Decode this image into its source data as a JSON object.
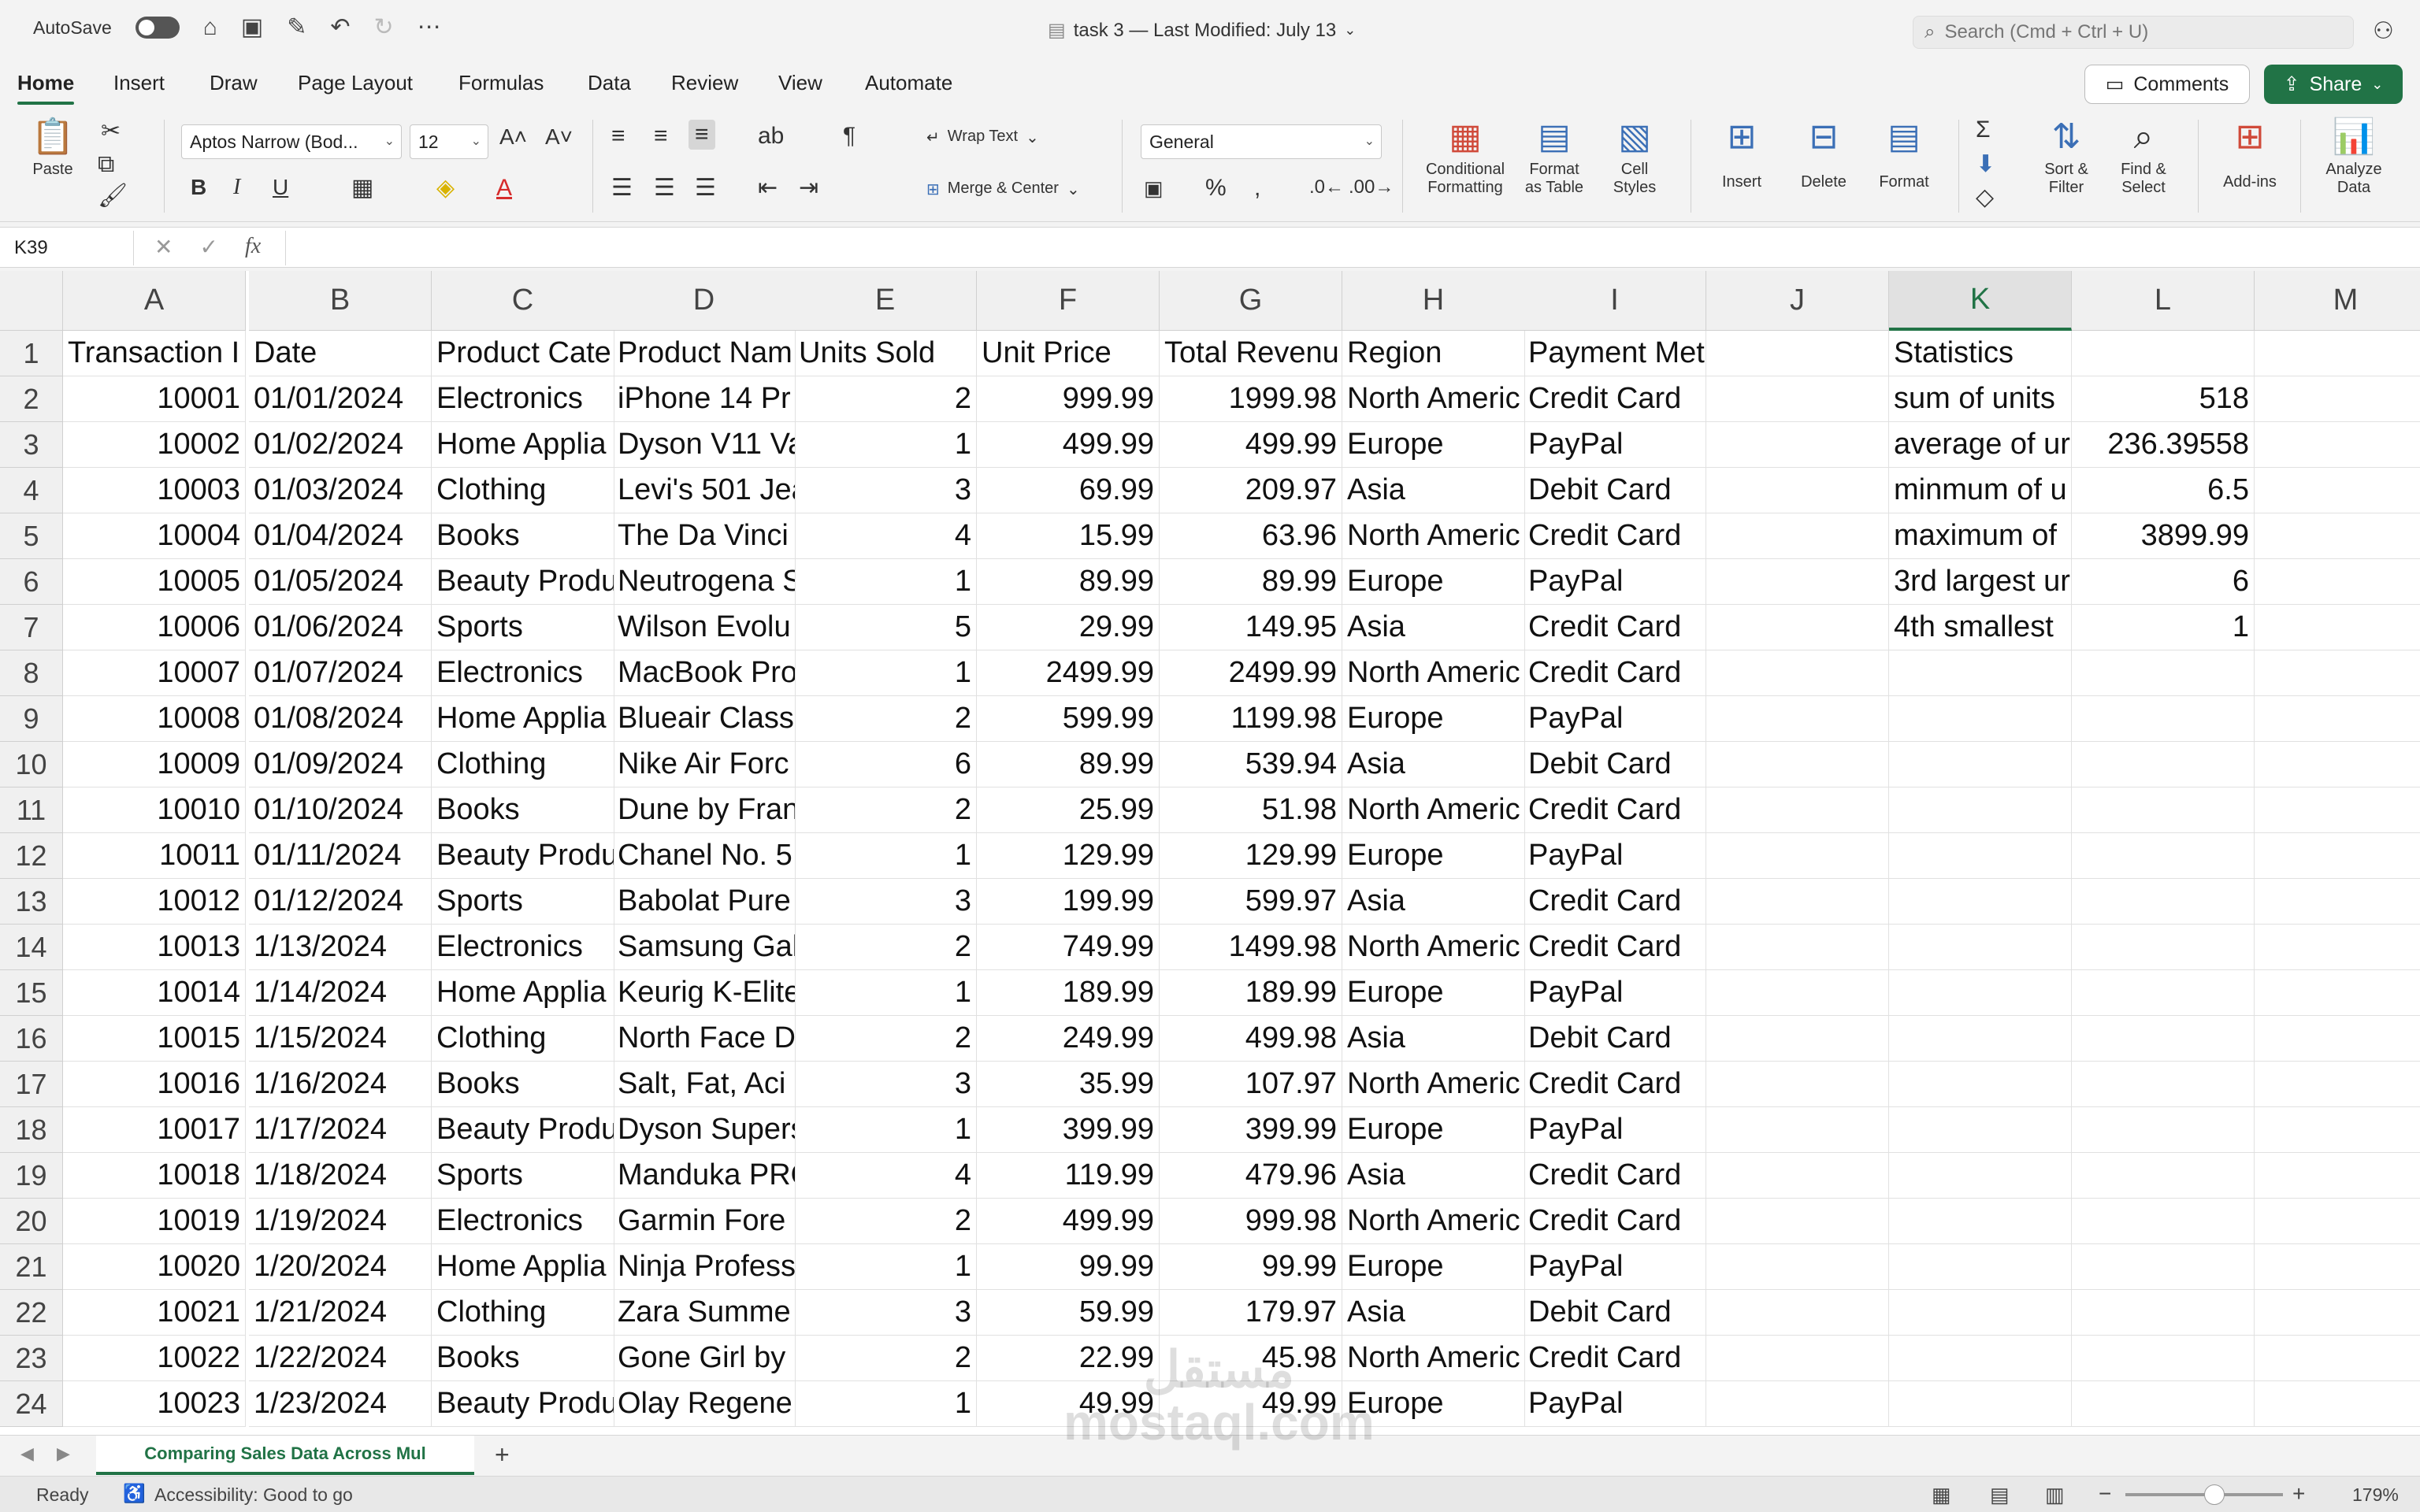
{
  "titlebar": {
    "autosave_label": "AutoSave",
    "document_title": "task 3 — Last Modified: July 13",
    "search_placeholder": "Search (Cmd + Ctrl + U)"
  },
  "tabs": [
    "Home",
    "Insert",
    "Draw",
    "Page Layout",
    "Formulas",
    "Data",
    "Review",
    "View",
    "Automate"
  ],
  "actions": {
    "comments": "Comments",
    "share": "Share"
  },
  "ribbon": {
    "paste": "Paste",
    "font_name": "Aptos Narrow (Bod...",
    "font_size": "12",
    "wrap_text": "Wrap Text",
    "merge_center": "Merge & Center",
    "number_format": "General",
    "conditional_formatting_1": "Conditional",
    "conditional_formatting_2": "Formatting",
    "format_as_table_1": "Format",
    "format_as_table_2": "as Table",
    "cell_styles_1": "Cell",
    "cell_styles_2": "Styles",
    "insert": "Insert",
    "delete": "Delete",
    "format": "Format",
    "sort_filter_1": "Sort &",
    "sort_filter_2": "Filter",
    "find_select_1": "Find &",
    "find_select_2": "Select",
    "addins": "Add-ins",
    "analyze_data_1": "Analyze",
    "analyze_data_2": "Data"
  },
  "formula_bar": {
    "name_box": "K39",
    "formula": ""
  },
  "columns": [
    "A",
    "B",
    "C",
    "D",
    "E",
    "F",
    "G",
    "H",
    "I",
    "J",
    "K",
    "L",
    "M"
  ],
  "selected_column": "K",
  "rows": [
    [
      "Transaction I",
      "Date",
      "Product Cate",
      "Product Nam",
      "Units Sold",
      "Unit Price",
      "Total Revenu",
      "Region",
      "Payment Method",
      "",
      "Statistics",
      "",
      ""
    ],
    [
      "10001",
      "01/01/2024",
      "Electronics",
      "iPhone 14 Pr",
      "2",
      "999.99",
      "1999.98",
      "North Americ",
      "Credit Card",
      "",
      "sum of units",
      "518",
      ""
    ],
    [
      "10002",
      "01/02/2024",
      "Home Applia",
      "Dyson V11 Va",
      "1",
      "499.99",
      "499.99",
      "Europe",
      "PayPal",
      "",
      "average of ur",
      "236.39558",
      ""
    ],
    [
      "10003",
      "01/03/2024",
      "Clothing",
      "Levi's 501 Jea",
      "3",
      "69.99",
      "209.97",
      "Asia",
      "Debit Card",
      "",
      "minmum of u",
      "6.5",
      ""
    ],
    [
      "10004",
      "01/04/2024",
      "Books",
      "The Da Vinci",
      "4",
      "15.99",
      "63.96",
      "North Americ",
      "Credit Card",
      "",
      "maximum of",
      "3899.99",
      ""
    ],
    [
      "10005",
      "01/05/2024",
      "Beauty Produ",
      "Neutrogena S",
      "1",
      "89.99",
      "89.99",
      "Europe",
      "PayPal",
      "",
      "3rd largest ur",
      "6",
      ""
    ],
    [
      "10006",
      "01/06/2024",
      "Sports",
      "Wilson Evolu",
      "5",
      "29.99",
      "149.95",
      "Asia",
      "Credit Card",
      "",
      "4th smallest",
      "1",
      ""
    ],
    [
      "10007",
      "01/07/2024",
      "Electronics",
      "MacBook Pro",
      "1",
      "2499.99",
      "2499.99",
      "North Americ",
      "Credit Card",
      "",
      "",
      "",
      ""
    ],
    [
      "10008",
      "01/08/2024",
      "Home Applia",
      "Blueair Class",
      "2",
      "599.99",
      "1199.98",
      "Europe",
      "PayPal",
      "",
      "",
      "",
      ""
    ],
    [
      "10009",
      "01/09/2024",
      "Clothing",
      "Nike Air Forc",
      "6",
      "89.99",
      "539.94",
      "Asia",
      "Debit Card",
      "",
      "",
      "",
      ""
    ],
    [
      "10010",
      "01/10/2024",
      "Books",
      "Dune by Fran",
      "2",
      "25.99",
      "51.98",
      "North Americ",
      "Credit Card",
      "",
      "",
      "",
      ""
    ],
    [
      "10011",
      "01/11/2024",
      "Beauty Produ",
      "Chanel No. 5",
      "1",
      "129.99",
      "129.99",
      "Europe",
      "PayPal",
      "",
      "",
      "",
      ""
    ],
    [
      "10012",
      "01/12/2024",
      "Sports",
      "Babolat Pure",
      "3",
      "199.99",
      "599.97",
      "Asia",
      "Credit Card",
      "",
      "",
      "",
      ""
    ],
    [
      "10013",
      "1/13/2024",
      "Electronics",
      "Samsung Gal",
      "2",
      "749.99",
      "1499.98",
      "North Americ",
      "Credit Card",
      "",
      "",
      "",
      ""
    ],
    [
      "10014",
      "1/14/2024",
      "Home Applia",
      "Keurig K-Elite",
      "1",
      "189.99",
      "189.99",
      "Europe",
      "PayPal",
      "",
      "",
      "",
      ""
    ],
    [
      "10015",
      "1/15/2024",
      "Clothing",
      "North Face D",
      "2",
      "249.99",
      "499.98",
      "Asia",
      "Debit Card",
      "",
      "",
      "",
      ""
    ],
    [
      "10016",
      "1/16/2024",
      "Books",
      "Salt, Fat, Aci",
      "3",
      "35.99",
      "107.97",
      "North Americ",
      "Credit Card",
      "",
      "",
      "",
      ""
    ],
    [
      "10017",
      "1/17/2024",
      "Beauty Produ",
      "Dyson Supers",
      "1",
      "399.99",
      "399.99",
      "Europe",
      "PayPal",
      "",
      "",
      "",
      ""
    ],
    [
      "10018",
      "1/18/2024",
      "Sports",
      "Manduka PRO",
      "4",
      "119.99",
      "479.96",
      "Asia",
      "Credit Card",
      "",
      "",
      "",
      ""
    ],
    [
      "10019",
      "1/19/2024",
      "Electronics",
      "Garmin Fore",
      "2",
      "499.99",
      "999.98",
      "North Americ",
      "Credit Card",
      "",
      "",
      "",
      ""
    ],
    [
      "10020",
      "1/20/2024",
      "Home Applia",
      "Ninja Profess",
      "1",
      "99.99",
      "99.99",
      "Europe",
      "PayPal",
      "",
      "",
      "",
      ""
    ],
    [
      "10021",
      "1/21/2024",
      "Clothing",
      "Zara Summe",
      "3",
      "59.99",
      "179.97",
      "Asia",
      "Debit Card",
      "",
      "",
      "",
      ""
    ],
    [
      "10022",
      "1/22/2024",
      "Books",
      "Gone Girl by",
      "2",
      "22.99",
      "45.98",
      "North Americ",
      "Credit Card",
      "",
      "",
      "",
      ""
    ],
    [
      "10023",
      "1/23/2024",
      "Beauty Produ",
      "Olay Regene",
      "1",
      "49.99",
      "49.99",
      "Europe",
      "PayPal",
      "",
      "",
      "",
      ""
    ]
  ],
  "sheet_tab": "Comparing Sales Data Across Mul",
  "status": {
    "ready": "Ready",
    "accessibility": "Accessibility: Good to go",
    "zoom": "179%"
  },
  "watermark": {
    "line1": "مستقل",
    "line2": "mostaql.com"
  },
  "colors": {
    "accent": "#217346",
    "ribbon_icon": "#3b6fb6"
  }
}
